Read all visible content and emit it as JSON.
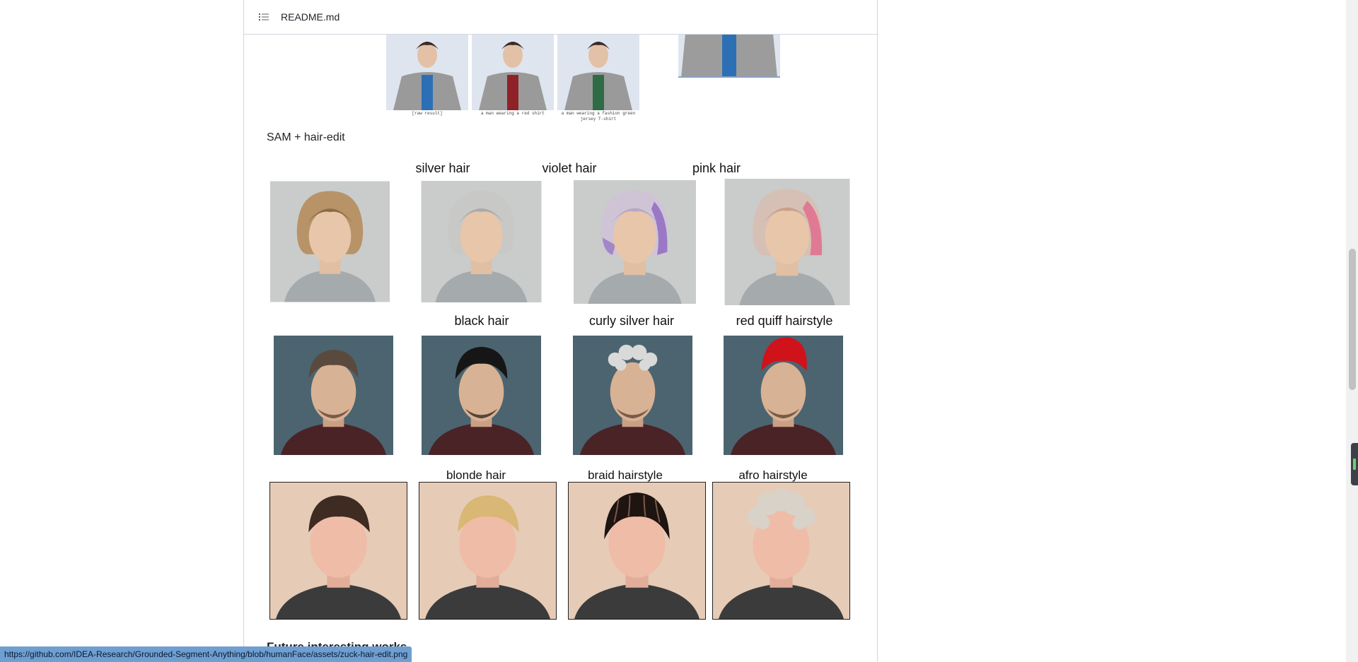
{
  "readme": {
    "file_name": "README.md"
  },
  "clothes_edit": {
    "captions": [
      "[raw result]",
      "a man wearing a red shirt",
      "a man wearing a fashion green jersey T-shirt"
    ]
  },
  "hair_edit": {
    "section_title": "SAM + hair-edit",
    "row1_labels": [
      "silver hair",
      "violet hair",
      "pink hair"
    ],
    "row2_labels": [
      "black hair",
      "curly silver hair",
      "red quiff hairstyle"
    ],
    "row3_labels": [
      "blonde hair",
      "braid hairstyle",
      "afro hairstyle"
    ]
  },
  "next_section": {
    "title": "Future interesting works"
  },
  "status_bar": {
    "url": "https://github.com/IDEA-Research/Grounded-Segment-Anything/blob/humanFace/assets/zuck-hair-edit.png"
  },
  "colors": {
    "shirt_blue": "#2d6fb5",
    "shirt_red": "#8f2228",
    "shirt_green": "#2f6b45",
    "status_blue": "#6f9ed1"
  }
}
